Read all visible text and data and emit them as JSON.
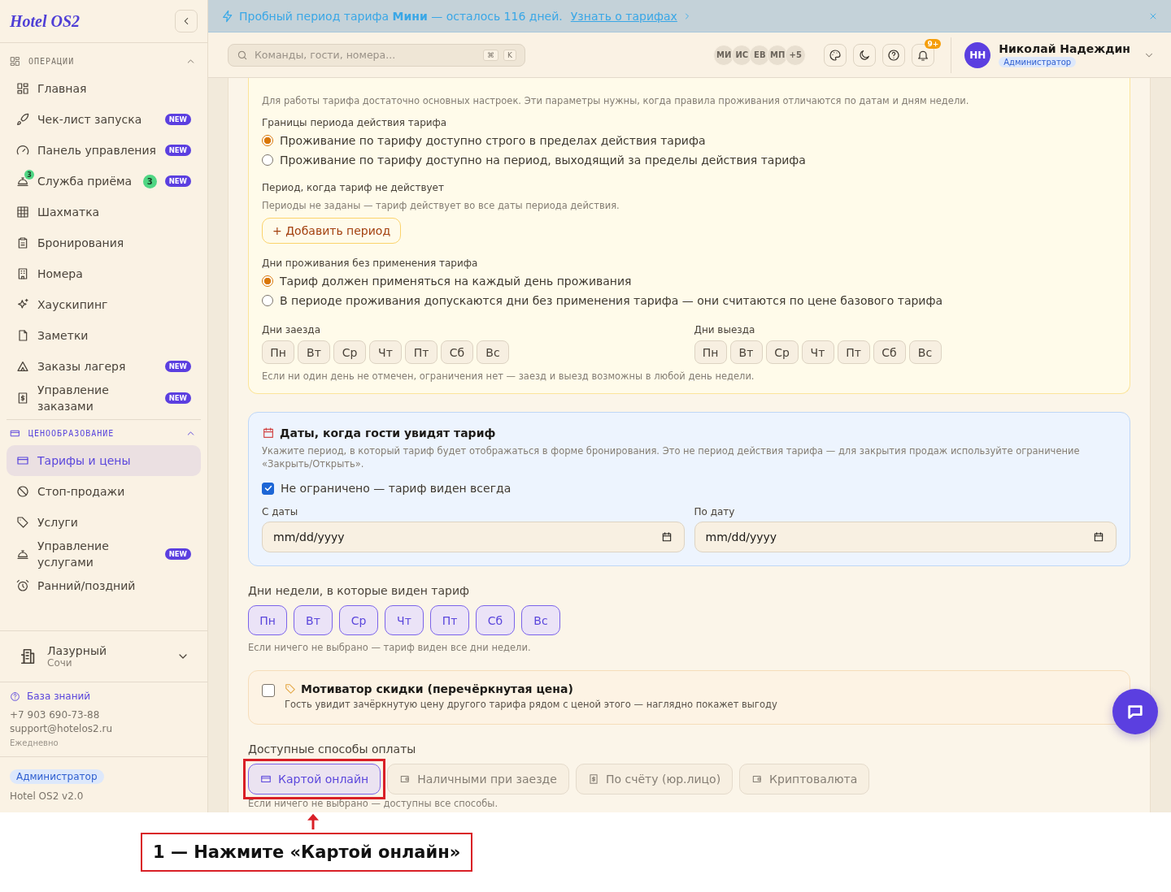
{
  "banner": {
    "text": "Пробный период тарифа **Мини** — осталось 116 дней.",
    "link": "Узнать о тарифах"
  },
  "sidebar": {
    "logo": "Hotel OS2",
    "sections": [
      {
        "title": "ОПЕРАЦИИ",
        "expanded": true,
        "items": [
          {
            "label": "Главная",
            "selected": false
          },
          {
            "label": "Чек-лист запуска",
            "selected": false,
            "badge": "NEW"
          },
          {
            "label": "Панель управления",
            "selected": false,
            "badge": "NEW"
          },
          {
            "label": "Служба приёма",
            "selected": false,
            "icon_count": "3",
            "count": "3",
            "badge": "NEW"
          },
          {
            "label": "Шахматка",
            "selected": false
          },
          {
            "label": "Бронирования",
            "selected": false
          },
          {
            "label": "Номера",
            "selected": false
          },
          {
            "label": "Хаускипинг",
            "selected": false
          },
          {
            "label": "Заметки",
            "selected": false
          },
          {
            "label": "Заказы лагеря",
            "selected": false,
            "badge": "NEW"
          },
          {
            "label": "Управление заказами",
            "selected": false,
            "badge": "NEW"
          }
        ]
      },
      {
        "title": "ЦЕНООБРАЗОВАНИЕ",
        "expanded": true,
        "items": [
          {
            "label": "Тарифы и цены",
            "selected": true
          },
          {
            "label": "Стоп-продажи",
            "selected": false
          },
          {
            "label": "Услуги",
            "selected": false
          },
          {
            "label": "Управление услугами",
            "selected": false,
            "badge": "NEW"
          },
          {
            "label": "Ранний/поздний",
            "selected": false
          }
        ]
      }
    ],
    "hotel": {
      "name": "Лазурный",
      "city": "Сочи"
    },
    "support": {
      "link": "База знаний",
      "phone": "+7 903 690-73-88",
      "email": "support@hotelos2.ru",
      "hours": "Ежедневно"
    },
    "role": "Администратор",
    "version": "Hotel OS2 v2.0"
  },
  "topbar": {
    "search": {
      "placeholder": "Команды, гости, номера..."
    },
    "keys": [
      "⌘",
      "K"
    ],
    "avatars": [
      "МИ",
      "ИС",
      "ЕВ",
      "МП"
    ],
    "avatars_more": "+5",
    "notifications": "9+",
    "user": {
      "initials": "НН",
      "name": "Николай Надеждин",
      "role": "Администратор"
    }
  },
  "advanced": {
    "description": "Для работы тарифа достаточно основных настроек. Эти параметры нужны, когда правила проживания отличаются по датам и дням недели.",
    "bounds": {
      "label": "Границы периода действия тарифа",
      "options": [
        {
          "label": "Проживание по тарифу доступно строго в пределах действия тарифа",
          "selected": true
        },
        {
          "label": "Проживание по тарифу доступно на период, выходящий за пределы действия тарифа",
          "selected": false
        }
      ]
    },
    "blackout": {
      "label": "Период, когда тариф не действует",
      "hint": "Периоды не заданы — тариф действует во все даты периода действия.",
      "button": "+ Добавить период"
    },
    "nights": {
      "label": "Дни проживания без применения тарифа",
      "options": [
        {
          "label": "Тариф должен применяться на каждый день проживания",
          "selected": true
        },
        {
          "label": "В периоде проживания допускаются дни без применения тарифа — они считаются по цене базового тарифа",
          "selected": false
        }
      ]
    },
    "day_groups": [
      {
        "label": "Дни заезда",
        "days": [
          {
            "label": "Пн",
            "selected": false
          },
          {
            "label": "Вт",
            "selected": false
          },
          {
            "label": "Ср",
            "selected": false
          },
          {
            "label": "Чт",
            "selected": false
          },
          {
            "label": "Пт",
            "selected": false
          },
          {
            "label": "Сб",
            "selected": false
          },
          {
            "label": "Вс",
            "selected": false
          }
        ]
      },
      {
        "label": "Дни выезда",
        "days": [
          {
            "label": "Пн",
            "selected": false
          },
          {
            "label": "Вт",
            "selected": false
          },
          {
            "label": "Ср",
            "selected": false
          },
          {
            "label": "Чт",
            "selected": false
          },
          {
            "label": "Пт",
            "selected": false
          },
          {
            "label": "Сб",
            "selected": false
          },
          {
            "label": "Вс",
            "selected": false
          }
        ]
      }
    ],
    "days_note": "Если ни один день не отмечен, ограничения нет — заезд и выезд возможны в любой день недели."
  },
  "visibility": {
    "title": "Даты, когда гости увидят тариф",
    "description": "Укажите период, в который тариф будет отображаться в форме бронирования. Это не период действия тарифа — для закрытия продаж используйте ограничение «Закрыть/Открыть».",
    "unlimited": {
      "label": "Не ограничено — тариф виден всегда",
      "checked": true
    },
    "fields": [
      {
        "label": "С даты",
        "value": "mm/dd/yyyy"
      },
      {
        "label": "По дату",
        "value": "mm/dd/yyyy"
      }
    ]
  },
  "weekdays": {
    "label": "Дни недели, в которые виден тариф",
    "days": [
      {
        "label": "Пн",
        "selected": true
      },
      {
        "label": "Вт",
        "selected": true
      },
      {
        "label": "Ср",
        "selected": true
      },
      {
        "label": "Чт",
        "selected": true
      },
      {
        "label": "Пт",
        "selected": true
      },
      {
        "label": "Сб",
        "selected": true
      },
      {
        "label": "Вс",
        "selected": true
      }
    ],
    "note": "Если ничего не выбрано — тариф виден все дни недели."
  },
  "motivator": {
    "checked": false,
    "title": "Мотиватор скидки (перечёркнутая цена)",
    "description": "Гость увидит зачёркнутую цену другого тарифа рядом с ценой этого — наглядно покажет выгоду"
  },
  "payment": {
    "label": "Доступные способы оплаты",
    "options": [
      {
        "label": "Картой онлайн",
        "selected": true
      },
      {
        "label": "Наличными при заезде",
        "selected": false
      },
      {
        "label": "По счёту (юр.лицо)",
        "selected": false
      },
      {
        "label": "Криптовалюта",
        "selected": false
      }
    ],
    "note": "Если ничего не выбрано — доступны все способы."
  },
  "annotation": {
    "text": "1 — Нажмите «Картой онлайн»"
  }
}
